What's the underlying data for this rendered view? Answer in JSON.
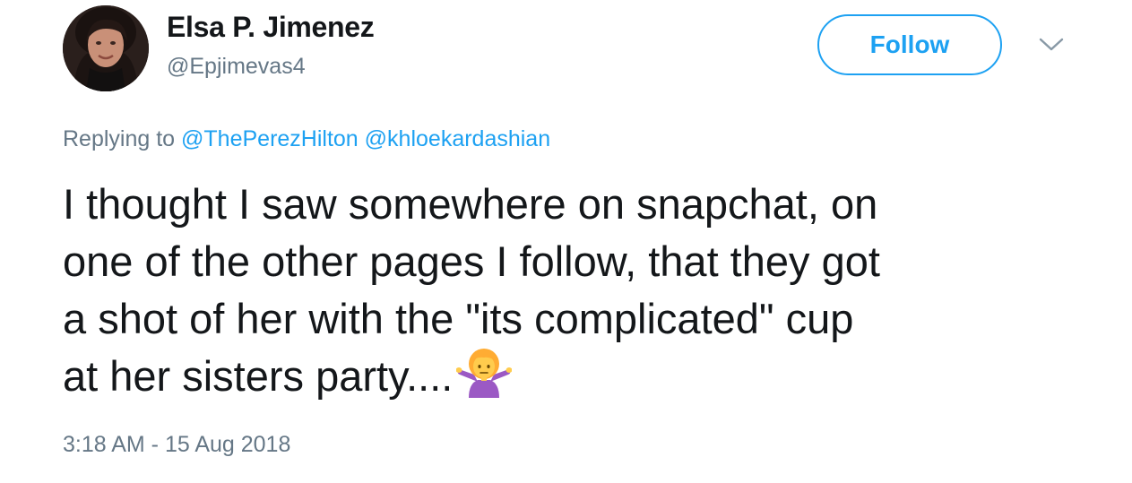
{
  "author": {
    "display_name": "Elsa P. Jimenez",
    "handle": "@Epjimevas4",
    "avatar_icon": "profile-photo"
  },
  "actions": {
    "follow_label": "Follow",
    "more_icon": "chevron-down-icon"
  },
  "reply": {
    "prefix": "Replying to",
    "mentions": [
      "@ThePerezHilton",
      "@khloekardashian"
    ]
  },
  "tweet": {
    "lines": [
      "I thought I saw somewhere on snapchat, on",
      "one of the other pages I follow, that they got",
      "a shot of her with the \"its complicated\" cup",
      "at her sisters party...."
    ],
    "emoji_icon": "person-shrugging-icon"
  },
  "meta": {
    "timestamp": "3:18 AM - 15 Aug 2018"
  },
  "colors": {
    "accent": "#1da1f2",
    "secondary_text": "#657786",
    "primary_text": "#14171a"
  }
}
